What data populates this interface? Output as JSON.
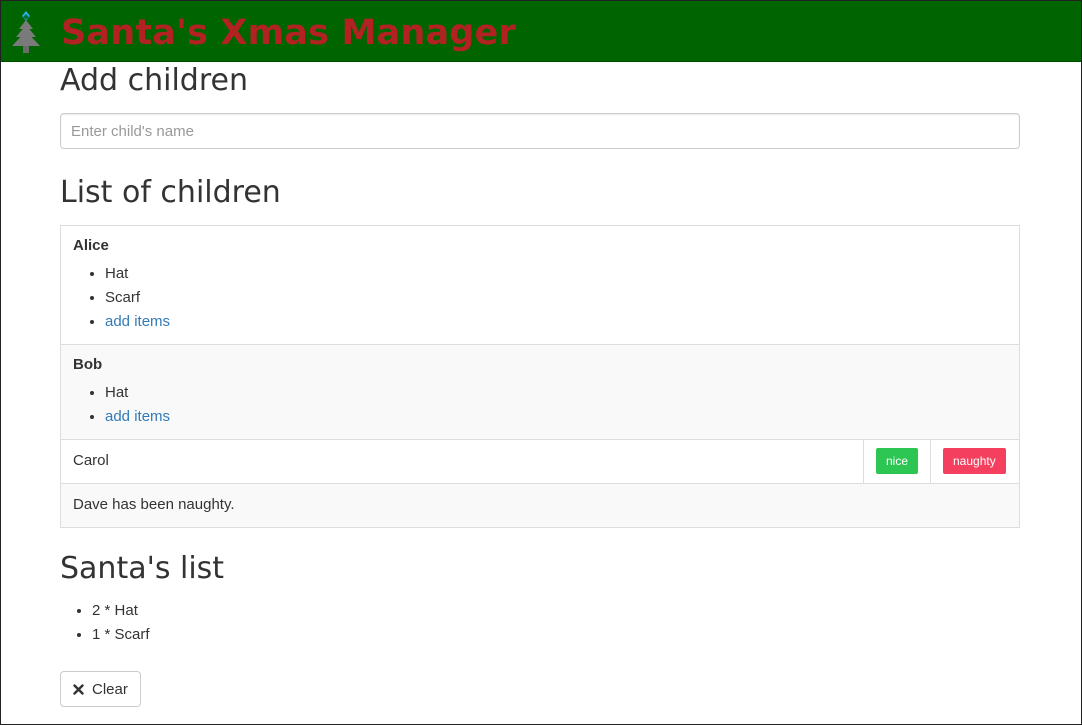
{
  "app": {
    "title": "Santa's Xmas Manager",
    "logo_icon": "christmas-tree-icon"
  },
  "add_section": {
    "heading": "Add children",
    "placeholder": "Enter child's name",
    "value": ""
  },
  "list_section": {
    "heading": "List of children",
    "children": [
      {
        "name": "Alice",
        "items": [
          "Hat",
          "Scarf"
        ],
        "add_label": "add items"
      },
      {
        "name": "Bob",
        "items": [
          "Hat"
        ],
        "add_label": "add items"
      },
      {
        "name": "Carol",
        "nice_label": "nice",
        "naughty_label": "naughty"
      },
      {
        "message": "Dave has been naughty."
      }
    ]
  },
  "santa_section": {
    "heading": "Santa's list",
    "items": [
      "2 * Hat",
      "1 * Scarf"
    ],
    "clear_label": "Clear",
    "clear_icon": "close-icon"
  },
  "colors": {
    "navbar": "#006400",
    "brand": "#b22222",
    "link": "#337ab7",
    "nice": "#2dc653",
    "naughty": "#f43f5e"
  }
}
